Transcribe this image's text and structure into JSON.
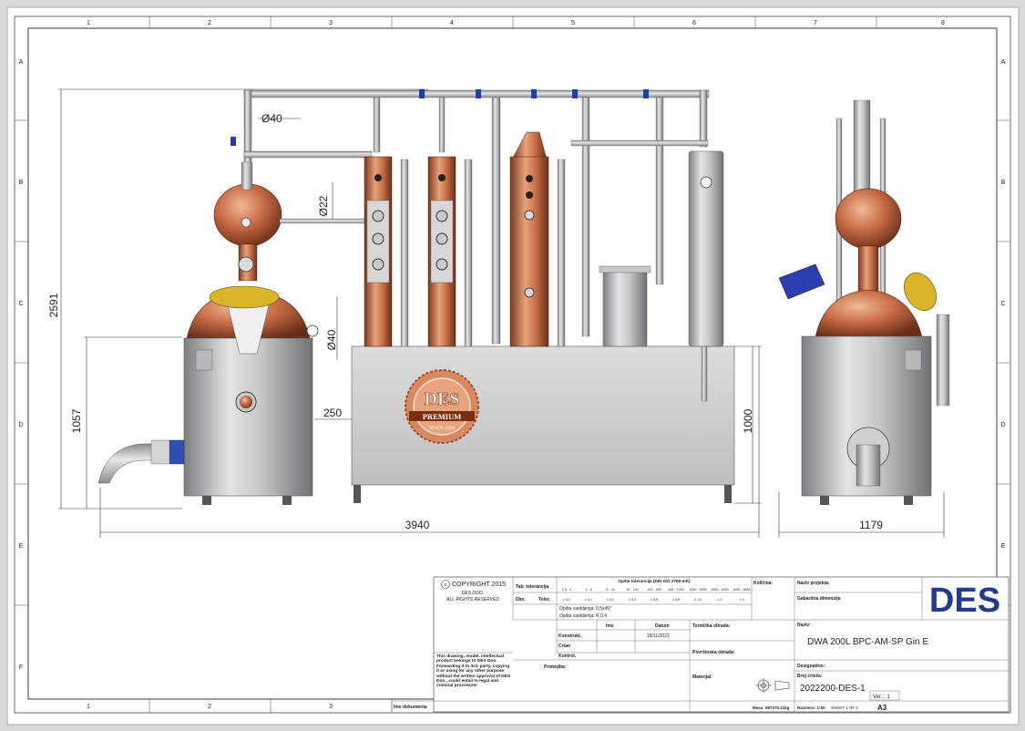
{
  "frame": {
    "columns": [
      "1",
      "2",
      "3",
      "4",
      "5",
      "6",
      "7",
      "8"
    ],
    "columns_bottom": [
      "1",
      "2",
      "3"
    ],
    "rows": [
      "A",
      "B",
      "C",
      "D",
      "E",
      "F"
    ]
  },
  "dimensions": {
    "height_total": "2591",
    "height_boiler": "1057",
    "width_total": "3940",
    "gap": "250",
    "height_base": "1000",
    "width_side": "1179",
    "pipe_top": "Ø40",
    "pipe_side": "Ø22",
    "pipe_lower": "Ø40"
  },
  "logo": {
    "brand": "DES",
    "ribbon": "PREMIUM",
    "since": "SINCE 1962"
  },
  "title_block": {
    "copyright": "COPYRIGHT 2015",
    "company": "DES DOO.",
    "rights": "ALL RIGHTS RESERVED",
    "tab_label": "Tab. tolerancija",
    "dim_label": "Dim.",
    "toler_label": "Toler.",
    "tol_header": "Opšte tolerancije (DIN ISO 2768-mK)",
    "tol_ranges": [
      "0,5 - 3",
      "3 - 6",
      "6 - 30",
      "30 - 120",
      "120 - 400",
      "400 - 1000",
      "1000 - 2000",
      "2000 - 4000",
      "4000 - 8000"
    ],
    "tol_values": [
      "± 0,1",
      "± 0,1",
      "± 0,2",
      "± 0,3",
      "± 0,5",
      "± 0,8",
      "± 1,2",
      "± 2",
      "± 3"
    ],
    "chamfer": "Opšta zaobljenja: 0,5x45°",
    "fillet": "Opšta zaobljenja: R 0,4",
    "ime_label": "Ime",
    "datum_label": "Datum",
    "konstrukt_label": "Konstrukt.",
    "crtao_label": "Crtao",
    "kontrol_label": "Kontrol.",
    "date": "18/11/2022",
    "primedba_label": "Primedba:",
    "disclaimer": "This drawing, model, intellectual product belongs to DES Doo. Forwarding it to 3rd. party, copying it or using for any other purpose without the written approval of DES Doo., could entail to legal and criminal procedure!",
    "kolicina_label": "Količina:",
    "termicka_label": "Termička obrada:",
    "povrsinska_label": "Površinska obrada:",
    "materijal_label": "Materijal:",
    "naziv_projekta_label": "Naziv projekta:",
    "gabaritna": "Gabaritna dimenzija",
    "naziv_label": "Naziv:",
    "naziv": "DWA 200L BPC-AM-SP Gin E",
    "designation_label": "Designation:",
    "broj_label": "Broj crteža:",
    "drawing_number": "2022200-DES-1",
    "ver": "Ver. :  1",
    "masa": "Masa: 587275.11kg",
    "razmera": "Razmera: 1:50",
    "sheet": "SHEET 1 OF 2",
    "format": "A3",
    "ime_dokumenta": "Ime dokumenta",
    "logo": "DES"
  }
}
